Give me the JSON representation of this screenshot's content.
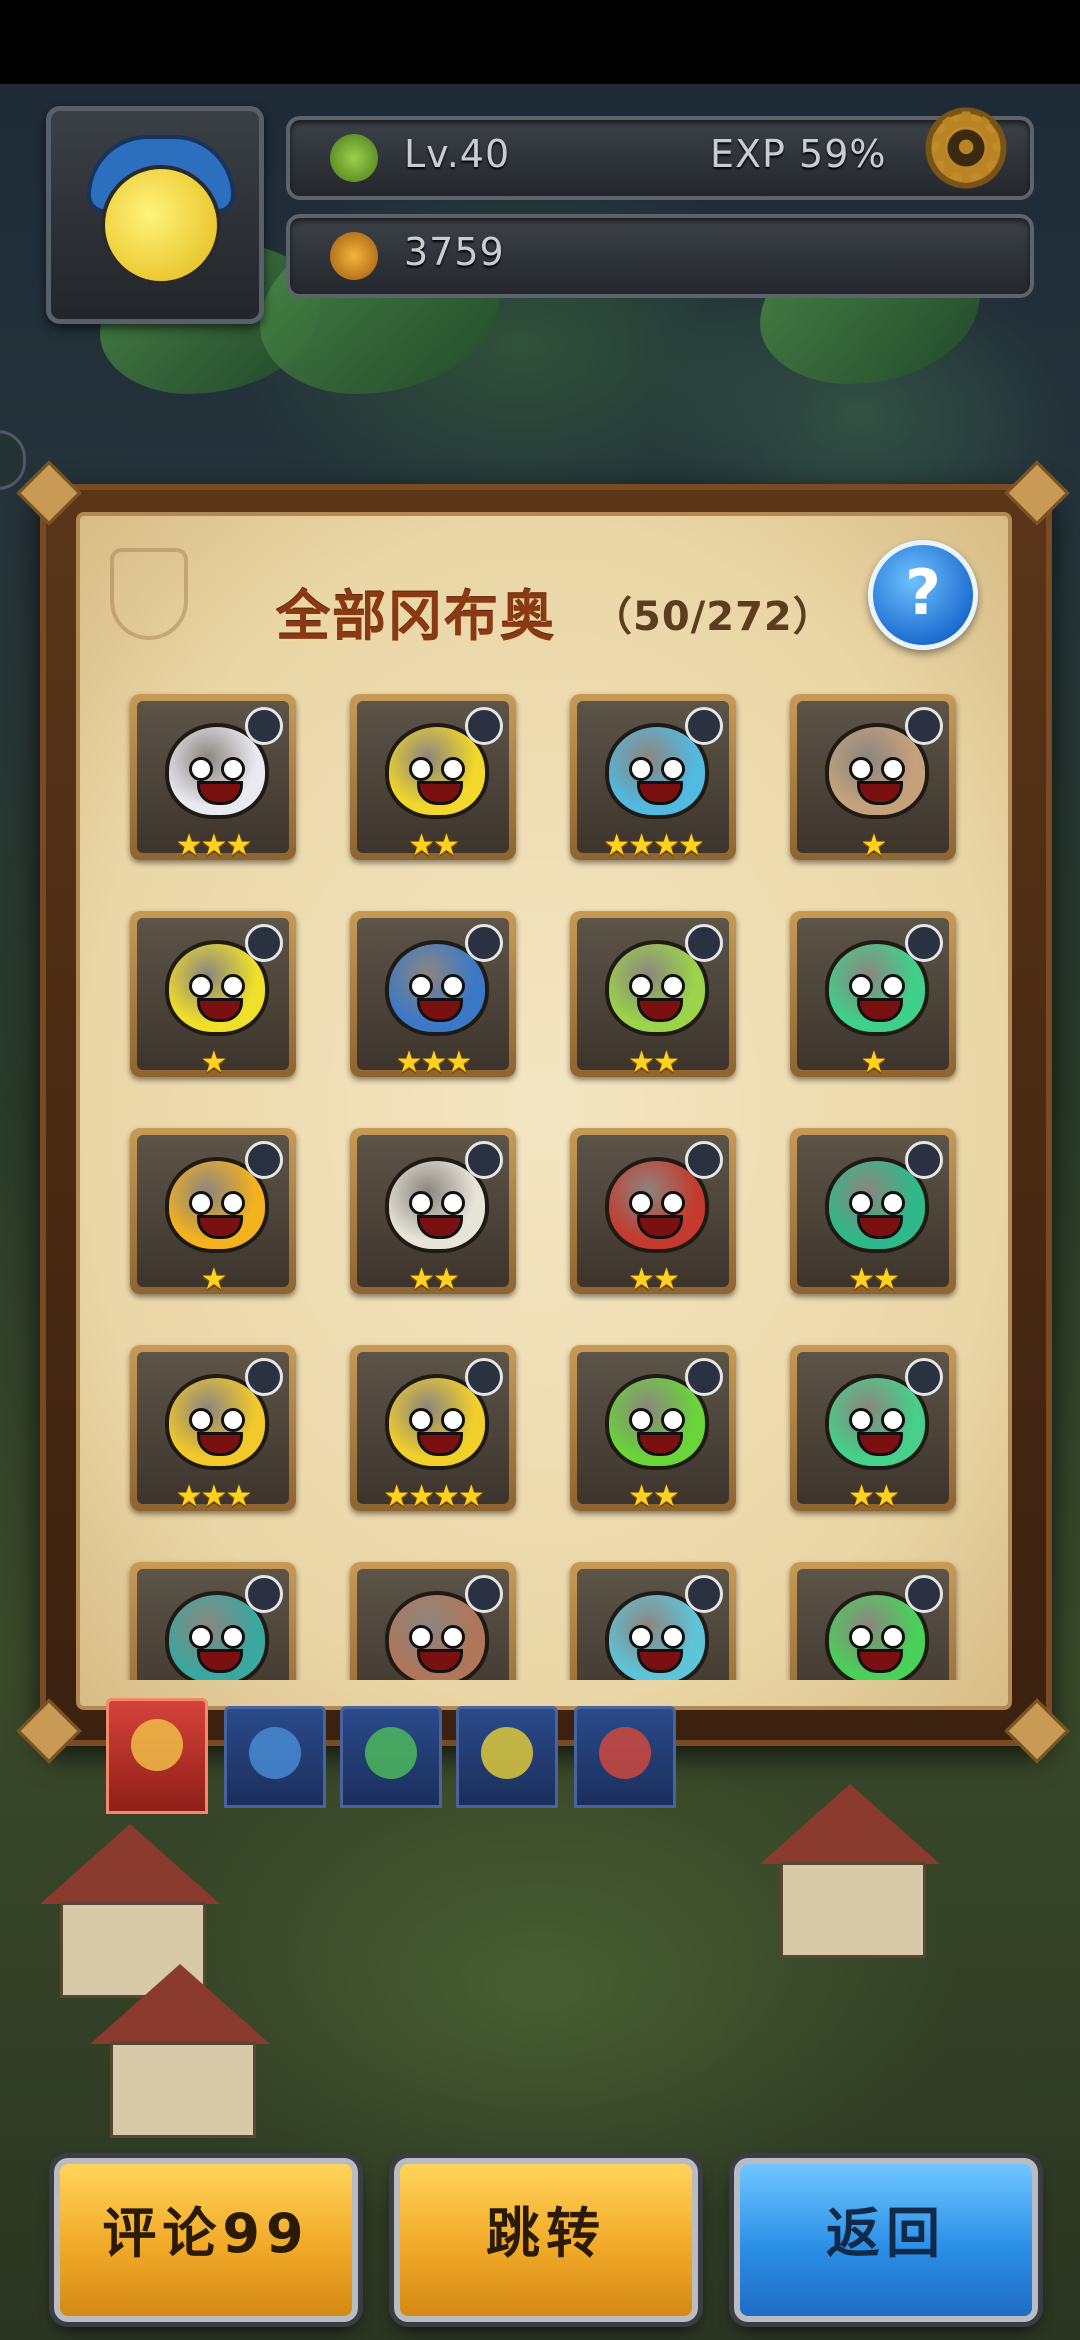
{
  "hud": {
    "level": "Lv.40",
    "exp": "EXP 59%",
    "coins": "3759"
  },
  "panel": {
    "title": "全部冈布奥",
    "count": "（50/272）"
  },
  "grid": [
    {
      "stars": "★★★",
      "color": "#e9e9f0"
    },
    {
      "stars": "★★",
      "color": "#f2d82a"
    },
    {
      "stars": "★★★★",
      "color": "#52b9e0"
    },
    {
      "stars": "★",
      "color": "#c6a27c"
    },
    {
      "stars": "★",
      "color": "#f0e02a"
    },
    {
      "stars": "★★★",
      "color": "#3c78c8"
    },
    {
      "stars": "★★",
      "color": "#9bd44a"
    },
    {
      "stars": "★",
      "color": "#3fd18a"
    },
    {
      "stars": "★",
      "color": "#f4b21f"
    },
    {
      "stars": "★★",
      "color": "#e8e4d8"
    },
    {
      "stars": "★★",
      "color": "#c43a2e"
    },
    {
      "stars": "★★",
      "color": "#2fb98a"
    },
    {
      "stars": "★★★",
      "color": "#f1c92a"
    },
    {
      "stars": "★★★★",
      "color": "#f2d02a"
    },
    {
      "stars": "★★",
      "color": "#6ad43a"
    },
    {
      "stars": "★★",
      "color": "#46d08a"
    },
    {
      "stars": "",
      "color": "#3aa7a0"
    },
    {
      "stars": "",
      "color": "#b0765a"
    },
    {
      "stars": "",
      "color": "#5fc4d8"
    },
    {
      "stars": "",
      "color": "#4bd05a"
    }
  ],
  "tabs": [
    {
      "color": "#f2c44a"
    },
    {
      "color": "#4a8fd8"
    },
    {
      "color": "#4fbf5a"
    },
    {
      "color": "#e8d23a"
    },
    {
      "color": "#d84a3a"
    }
  ],
  "buttons": {
    "comment": "评论99",
    "jump": "跳转",
    "back": "返回"
  }
}
